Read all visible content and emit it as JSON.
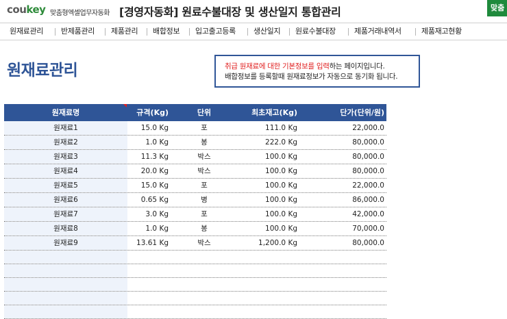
{
  "header": {
    "logo_prefix": "cou",
    "logo_highlight": "key",
    "logo_subtitle": "맞춤형엑셀업무자동화",
    "title": "[경영자동화] 원료수불대장 및 생산일지 통합관리",
    "corner_button": "맞춤"
  },
  "nav": {
    "items": [
      "원재료관리",
      "반제품관리",
      "제품관리",
      "배합정보",
      "입고출고등록",
      "생산일지",
      "원료수불대장",
      "제품거래내역서",
      "제품재고현황"
    ]
  },
  "page_title": "원재료관리",
  "info": {
    "line1_red": "취급 원재료에 대한 기본정보를 입력",
    "line1_rest": "하는 페이지입니다.",
    "line2": "배합정보를 등록할때 원재료정보가 자동으로 동기화 됩니다."
  },
  "table": {
    "headers": [
      "원재료명",
      "규격(Kg)",
      "단위",
      "최초재고(Kg)",
      "단가(단위/원)"
    ],
    "rows": [
      [
        "원재료1",
        "15.0 Kg",
        "포",
        "111.0 Kg",
        "22,000.0"
      ],
      [
        "원재료2",
        "1.0 Kg",
        "봉",
        "222.0 Kg",
        "80,000.0"
      ],
      [
        "원재료3",
        "11.3 Kg",
        "박스",
        "100.0 Kg",
        "80,000.0"
      ],
      [
        "원재료4",
        "20.0 Kg",
        "박스",
        "100.0 Kg",
        "80,000.0"
      ],
      [
        "원재료5",
        "15.0 Kg",
        "포",
        "100.0 Kg",
        "22,000.0"
      ],
      [
        "원재료6",
        "0.65 Kg",
        "병",
        "100.0 Kg",
        "86,000.0"
      ],
      [
        "원재료7",
        "3.0 Kg",
        "포",
        "100.0 Kg",
        "42,000.0"
      ],
      [
        "원재료8",
        "1.0 Kg",
        "봉",
        "100.0 Kg",
        "70,000.0"
      ],
      [
        "원재료9",
        "13.61 Kg",
        "박스",
        "1,200.0 Kg",
        "80,000.0"
      ]
    ]
  },
  "colors": {
    "accent": "#2f5597",
    "brand_green": "#1f8a3c",
    "highlight_red": "#e02020",
    "name_column_fill": "#eef3fb"
  }
}
